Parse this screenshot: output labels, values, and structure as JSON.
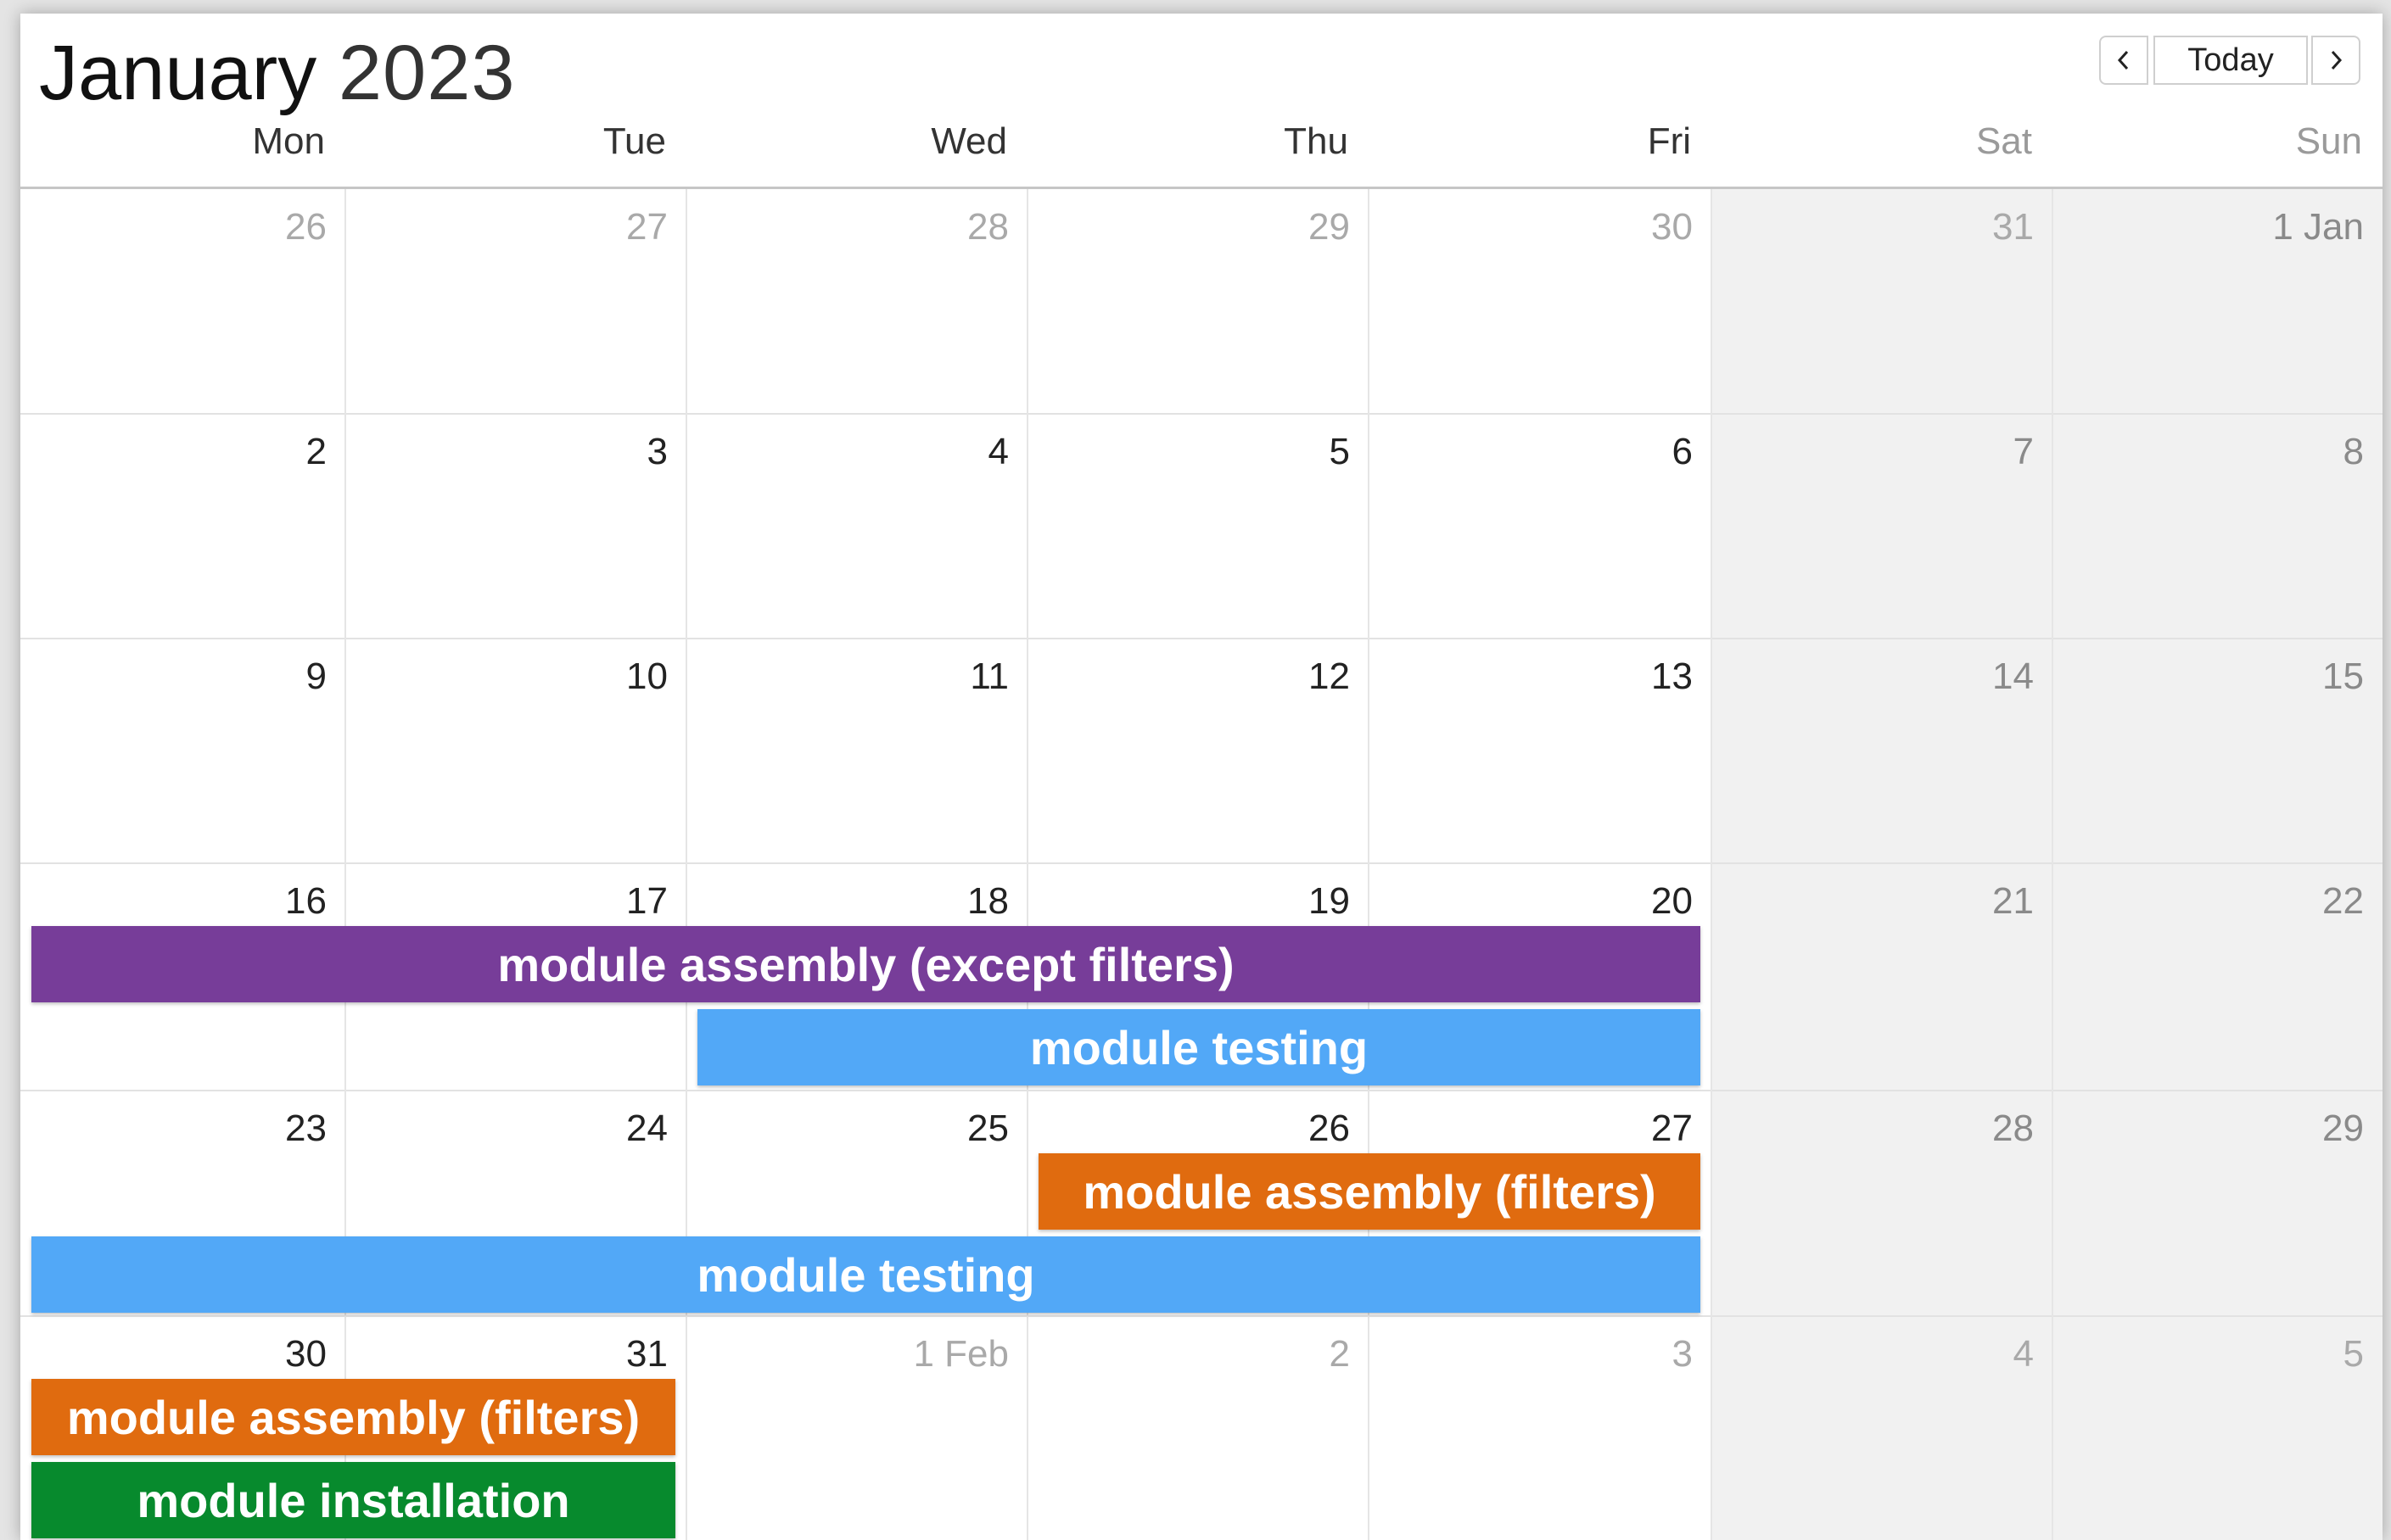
{
  "header": {
    "month": "January",
    "year": "2023",
    "today_label": "Today"
  },
  "icons": {
    "prev": "chevron-left-icon",
    "next": "chevron-right-icon"
  },
  "weekdays": [
    "Mon",
    "Tue",
    "Wed",
    "Thu",
    "Fri",
    "Sat",
    "Sun"
  ],
  "weeks": [
    [
      {
        "label": "26",
        "current": false
      },
      {
        "label": "27",
        "current": false
      },
      {
        "label": "28",
        "current": false
      },
      {
        "label": "29",
        "current": false
      },
      {
        "label": "30",
        "current": false
      },
      {
        "label": "31",
        "current": false
      },
      {
        "label": "1 Jan",
        "current": true
      }
    ],
    [
      {
        "label": "2",
        "current": true
      },
      {
        "label": "3",
        "current": true
      },
      {
        "label": "4",
        "current": true
      },
      {
        "label": "5",
        "current": true
      },
      {
        "label": "6",
        "current": true
      },
      {
        "label": "7",
        "current": true
      },
      {
        "label": "8",
        "current": true
      }
    ],
    [
      {
        "label": "9",
        "current": true
      },
      {
        "label": "10",
        "current": true
      },
      {
        "label": "11",
        "current": true
      },
      {
        "label": "12",
        "current": true
      },
      {
        "label": "13",
        "current": true
      },
      {
        "label": "14",
        "current": true
      },
      {
        "label": "15",
        "current": true
      }
    ],
    [
      {
        "label": "16",
        "current": true
      },
      {
        "label": "17",
        "current": true
      },
      {
        "label": "18",
        "current": true
      },
      {
        "label": "19",
        "current": true
      },
      {
        "label": "20",
        "current": true
      },
      {
        "label": "21",
        "current": true
      },
      {
        "label": "22",
        "current": true
      }
    ],
    [
      {
        "label": "23",
        "current": true
      },
      {
        "label": "24",
        "current": true
      },
      {
        "label": "25",
        "current": true
      },
      {
        "label": "26",
        "current": true
      },
      {
        "label": "27",
        "current": true
      },
      {
        "label": "28",
        "current": true
      },
      {
        "label": "29",
        "current": true
      }
    ],
    [
      {
        "label": "30",
        "current": true
      },
      {
        "label": "31",
        "current": true
      },
      {
        "label": "1 Feb",
        "current": false
      },
      {
        "label": "2",
        "current": false
      },
      {
        "label": "3",
        "current": false
      },
      {
        "label": "4",
        "current": false
      },
      {
        "label": "5",
        "current": false
      }
    ]
  ],
  "events": [
    {
      "title": "module assembly (except filters)",
      "color": "#773d99",
      "start_date": "2023-01-16",
      "end_date": "2023-01-20"
    },
    {
      "title": "module testing",
      "color": "#52a8f7",
      "start_date": "2023-01-18",
      "end_date": "2023-01-20"
    },
    {
      "title": "module assembly (filters)",
      "color": "#e06b0f",
      "start_date": "2023-01-26",
      "end_date": "2023-01-27"
    },
    {
      "title": "module testing",
      "color": "#52a8f7",
      "start_date": "2023-01-23",
      "end_date": "2023-01-27"
    },
    {
      "title": "module assembly (filters)",
      "color": "#e06b0f",
      "start_date": "2023-01-30",
      "end_date": "2023-01-31"
    },
    {
      "title": "module installation",
      "color": "#078a2d",
      "start_date": "2023-01-30",
      "end_date": "2023-01-31"
    }
  ],
  "colors": {
    "weekend_bg": "#f1f1f1"
  }
}
